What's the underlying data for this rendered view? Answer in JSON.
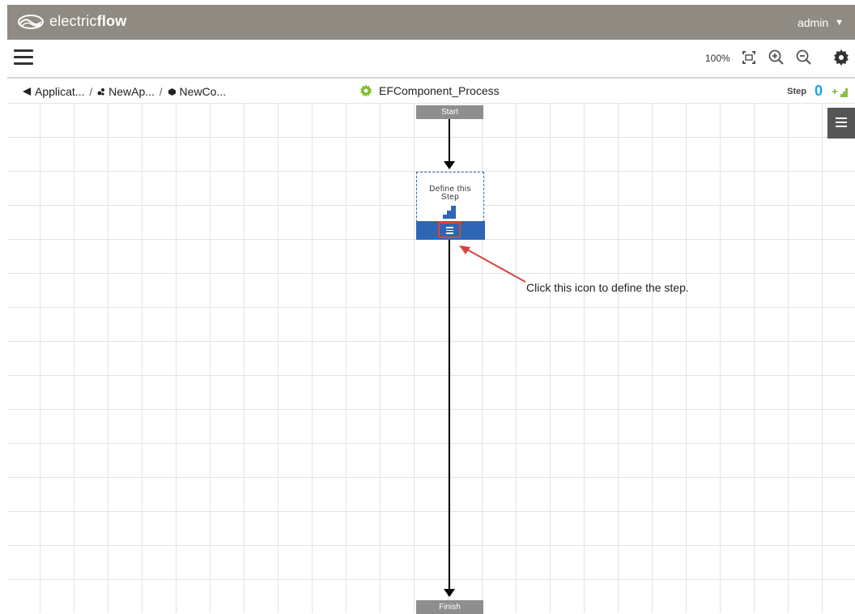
{
  "header": {
    "brand_light": "electric",
    "brand_bold": "flow",
    "user": "admin"
  },
  "toolbar": {
    "zoom": "100%",
    "icons": [
      "fit-to-screen-icon",
      "zoom-in-icon",
      "zoom-out-icon",
      "settings-gear-icon"
    ]
  },
  "breadcrumb": {
    "items": [
      {
        "label": "Applicat...",
        "icon": "back-triangle-icon"
      },
      {
        "label": "NewAp...",
        "icon": "application-icon"
      },
      {
        "label": "NewCo...",
        "icon": "component-icon"
      }
    ],
    "separator": "/"
  },
  "process": {
    "title": "EFComponent_Process",
    "icon": "process-gear-icon"
  },
  "step_controls": {
    "label": "Step",
    "count": "0"
  },
  "diagram": {
    "start_label": "Start",
    "finish_label": "Finish",
    "step_text_line1": "Define this",
    "step_text_line2": "Step"
  },
  "annotation": {
    "text": "Click this icon to define the step."
  },
  "colors": {
    "header_bg": "#8f8b82",
    "step_blue": "#2e66b5",
    "step_count": "#1aa3e8",
    "callout_red": "#d64640",
    "node_gray": "#8e8e8e"
  }
}
